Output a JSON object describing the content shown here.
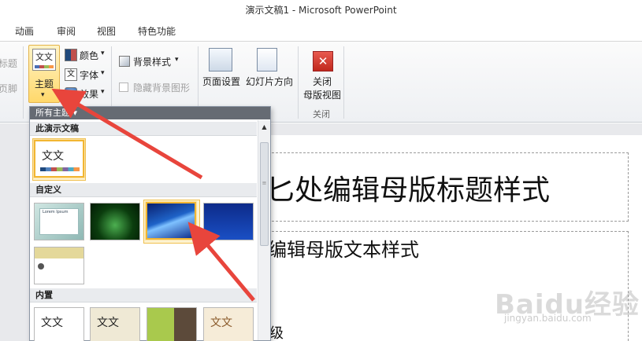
{
  "window": {
    "title": "演示文稿1 - Microsoft PowerPoint"
  },
  "tabs": [
    "动画",
    "审阅",
    "视图",
    "特色功能"
  ],
  "ribbon": {
    "left_cut": {
      "title": "标题",
      "footer": "页脚"
    },
    "theme": {
      "icon_text": "文文",
      "label": "主题",
      "caret": "▾"
    },
    "colors": "颜色",
    "fonts": "字体",
    "effects": "效果",
    "background_style": "背景样式",
    "hide_bg": "隐藏背景图形",
    "page_setup": "页面设置",
    "slide_orientation": "幻灯片方向",
    "close_line1": "关闭",
    "close_line2": "母版视图",
    "close_group": "关闭"
  },
  "dropdown": {
    "header": "所有主题 ▾",
    "section_this": "此演示文稿",
    "section_custom": "自定义",
    "section_builtin": "内置",
    "thumb_text": "文文",
    "lorem_title": "Lorem Ipsum"
  },
  "slide": {
    "title": "匕处编辑母版标题样式",
    "body": "编辑母版文本样式",
    "level": "级"
  },
  "watermark": {
    "main": "Baidu经验",
    "sub": "jingyan.baidu.com"
  }
}
